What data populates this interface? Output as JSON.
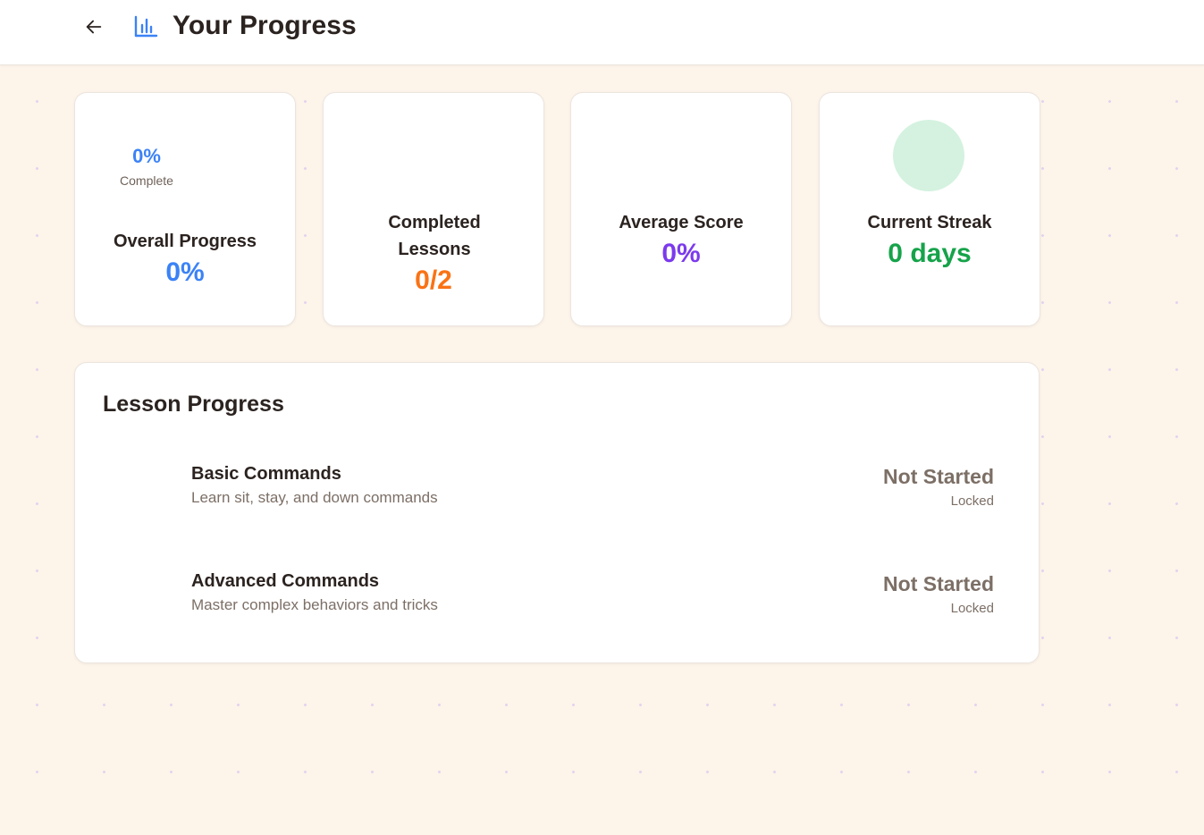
{
  "header": {
    "title": "Your Progress",
    "back_icon": "arrow-left-icon",
    "title_icon": "bar-chart-icon",
    "accent_color": "#3b82f6"
  },
  "stats": {
    "overall": {
      "ring_percent": "0%",
      "ring_caption": "Complete",
      "label": "Overall Progress",
      "value": "0%",
      "color": "#3b82f6"
    },
    "completed": {
      "label": "Completed Lessons",
      "value": "0/2",
      "color": "#f97316"
    },
    "average": {
      "label": "Average Score",
      "value": "0%",
      "color": "#7c3aed"
    },
    "streak": {
      "label": "Current Streak",
      "value": "0 days",
      "color": "#16a34a"
    }
  },
  "lesson_progress": {
    "title": "Lesson Progress",
    "lessons": [
      {
        "name": "Basic Commands",
        "description": "Learn sit, stay, and down commands",
        "status": "Not Started",
        "lock_state": "Locked"
      },
      {
        "name": "Advanced Commands",
        "description": "Master complex behaviors and tricks",
        "status": "Not Started",
        "lock_state": "Locked"
      }
    ]
  }
}
